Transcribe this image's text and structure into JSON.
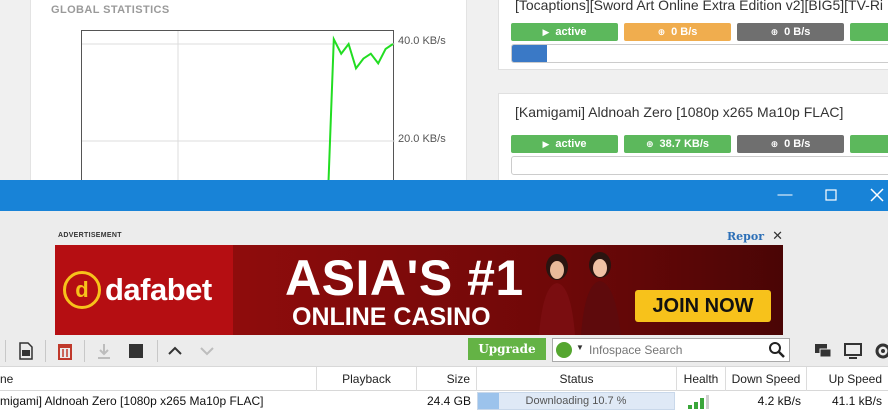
{
  "web_page": {
    "stats_title": "GLOBAL STATISTICS",
    "chart_data": {
      "type": "line",
      "title": "GLOBAL STATISTICS",
      "yticks": [
        "40.0 KB/s",
        "20.0 KB/s"
      ],
      "ylim": [
        0,
        45
      ],
      "grid": true,
      "series": [
        {
          "values": [
            0,
            0,
            0,
            0,
            0,
            0,
            0,
            0,
            0,
            0,
            0,
            0,
            0,
            0,
            0,
            0,
            0,
            0,
            0,
            0,
            0,
            0,
            0,
            0,
            0,
            0,
            0,
            0,
            0,
            0,
            0,
            0,
            0,
            0,
            41,
            38,
            40,
            35,
            37,
            38,
            36,
            39,
            40
          ]
        }
      ]
    },
    "cards": [
      {
        "title": "[Tocaptions][Sword Art Online Extra Edition v2][BIG5][TV-Ri",
        "state": "active",
        "down": "0 B/s",
        "up": "0 B/s",
        "progress": 0.09
      },
      {
        "title": "[Kamigami] Aldnoah Zero [1080p x265 Ma10p FLAC]",
        "state": "active",
        "down": "38.7 KB/s",
        "up": "0 B/s",
        "progress": 0.0
      }
    ],
    "colors": {
      "active": "#5cb85c",
      "down_idle": "#f0ad4e",
      "up": "#6f6f6f",
      "progress": "#3a79c6",
      "graph_line": "#22dd22"
    }
  },
  "window": {
    "titlebar_color": "#1883d7",
    "minimize_icon": "minimize-icon",
    "maximize_icon": "maximize-icon",
    "close_icon": "close-icon"
  },
  "ad": {
    "label": "ADVERTISEMENT",
    "report": "Repor",
    "brand": "dafabet",
    "headline": "ASIA'S #1",
    "subheadline": "ONLINE CASINO",
    "cta": "JOIN NOW"
  },
  "toolbar": {
    "icons": [
      "document-icon",
      "trash-icon",
      "download-icon",
      "stop-icon",
      "chevron-up-icon",
      "chevron-down-icon"
    ],
    "upgrade": "Upgrade",
    "search_placeholder": "Infospace Search",
    "right_icons": [
      "chat-icon",
      "monitor-icon",
      "gear-icon"
    ]
  },
  "table": {
    "columns": [
      "ne",
      "Playback",
      "Size",
      "Status",
      "Health",
      "Down Speed",
      "Up Speed"
    ],
    "rows": [
      {
        "name": "migami] Aldnoah Zero [1080p x265 Ma10p FLAC]",
        "size": "24.4 GB",
        "status": "Downloading 10.7 %",
        "progress": 0.107,
        "down": "4.2 kB/s",
        "up": "41.1 kB/s"
      }
    ]
  }
}
